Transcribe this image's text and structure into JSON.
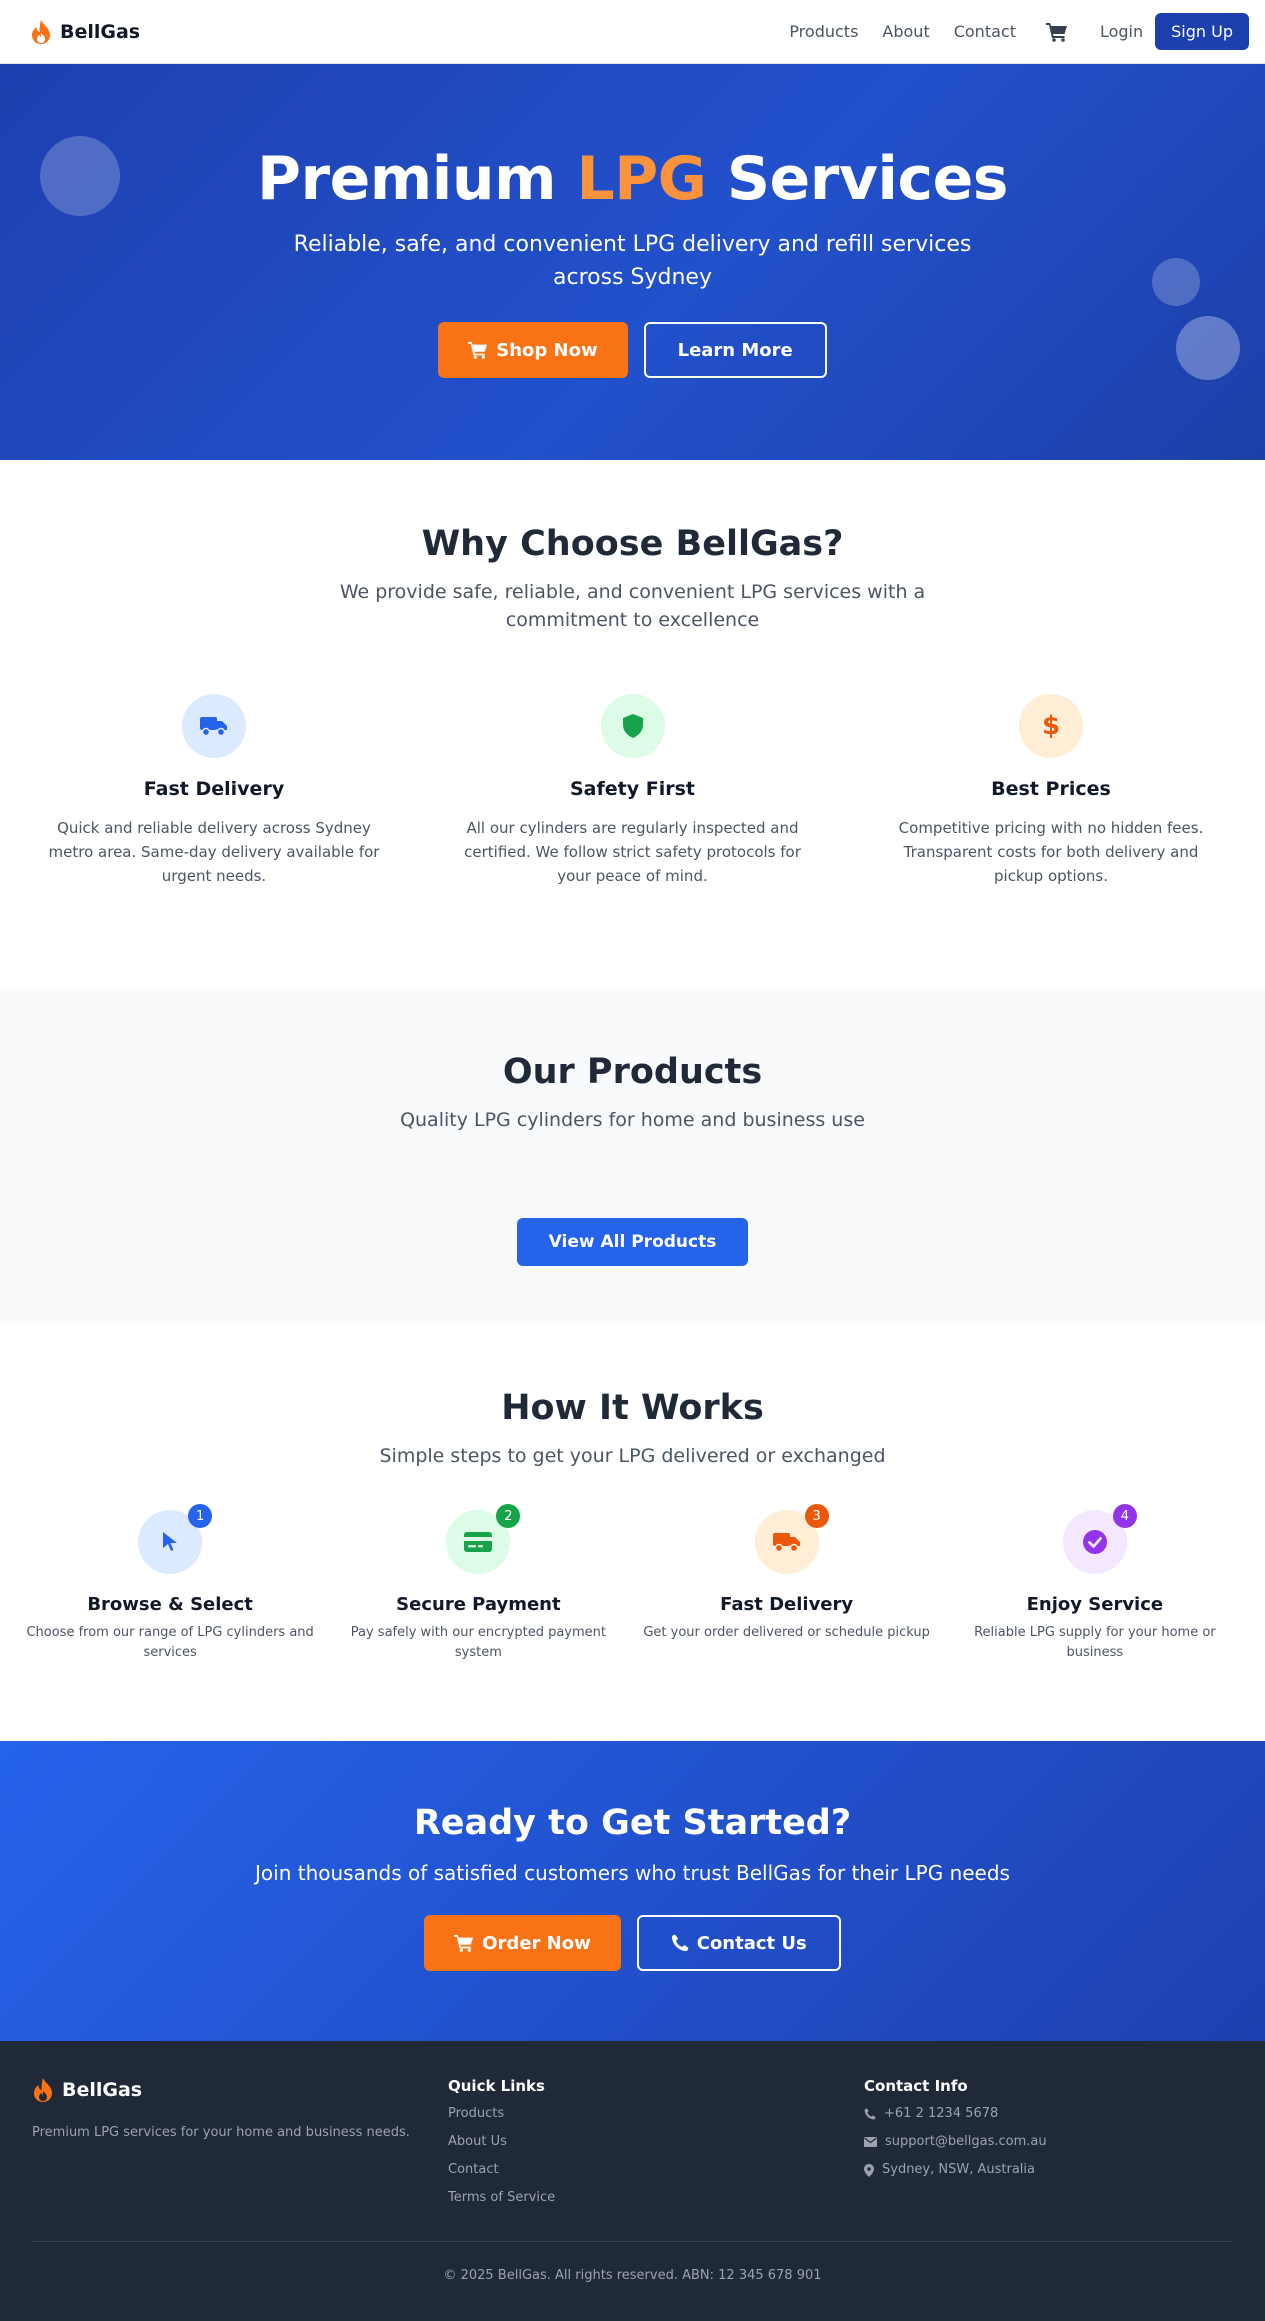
{
  "nav": {
    "brand": "BellGas",
    "links": [
      "Products",
      "About",
      "Contact"
    ],
    "login": "Login",
    "signup": "Sign Up"
  },
  "hero": {
    "title_pre": "Premium ",
    "title_accent": "LPG",
    "title_post": " Services",
    "subtitle": "Reliable, safe, and convenient LPG delivery and refill services across Sydney",
    "primary_button": "Shop Now",
    "secondary_button": "Learn More"
  },
  "why": {
    "title": "Why Choose BellGas?",
    "subtitle": "We provide safe, reliable, and convenient LPG services with a commitment to excellence",
    "features": [
      {
        "title": "Fast Delivery",
        "text": "Quick and reliable delivery across Sydney metro area. Same-day delivery available for urgent needs.",
        "icon": "truck-icon"
      },
      {
        "title": "Safety First",
        "text": "All our cylinders are regularly inspected and certified. We follow strict safety protocols for your peace of mind.",
        "icon": "shield-icon"
      },
      {
        "title": "Best Prices",
        "text": "Competitive pricing with no hidden fees. Transparent costs for both delivery and pickup options.",
        "icon": "dollar-icon"
      }
    ]
  },
  "products": {
    "title": "Our Products",
    "subtitle": "Quality LPG cylinders for home and business use",
    "button": "View All Products"
  },
  "how": {
    "title": "How It Works",
    "subtitle": "Simple steps to get your LPG delivered or exchanged",
    "steps": [
      {
        "number": "1",
        "title": "Browse & Select",
        "text": "Choose from our range of LPG cylinders and services",
        "icon": "cursor-icon"
      },
      {
        "number": "2",
        "title": "Secure Payment",
        "text": "Pay safely with our encrypted payment system",
        "icon": "credit-card-icon"
      },
      {
        "number": "3",
        "title": "Fast Delivery",
        "text": "Get your order delivered or schedule pickup",
        "icon": "truck-icon"
      },
      {
        "number": "4",
        "title": "Enjoy Service",
        "text": "Reliable LPG supply for your home or business",
        "icon": "check-circle-icon"
      }
    ]
  },
  "cta": {
    "title": "Ready to Get Started?",
    "subtitle": "Join thousands of satisfied customers who trust BellGas for their LPG needs",
    "primary_button": "Order Now",
    "secondary_button": "Contact Us"
  },
  "footer": {
    "brand": "BellGas",
    "description": "Premium LPG services for your home and business needs.",
    "quick_links_title": "Quick Links",
    "quick_links": [
      "Products",
      "About Us",
      "Contact",
      "Terms of Service"
    ],
    "contact_title": "Contact Info",
    "phone": "+61 2 1234 5678",
    "email": "support@bellgas.com.au",
    "location": "Sydney, NSW, Australia",
    "copyright": "© 2025 BellGas. All rights reserved. ABN: 12 345 678 901"
  },
  "colors": {
    "primary": "#1e40af",
    "accent": "#f97316",
    "blue": "#2563eb",
    "green": "#16a34a",
    "purple": "#9333ea",
    "dark": "#1f2937"
  }
}
